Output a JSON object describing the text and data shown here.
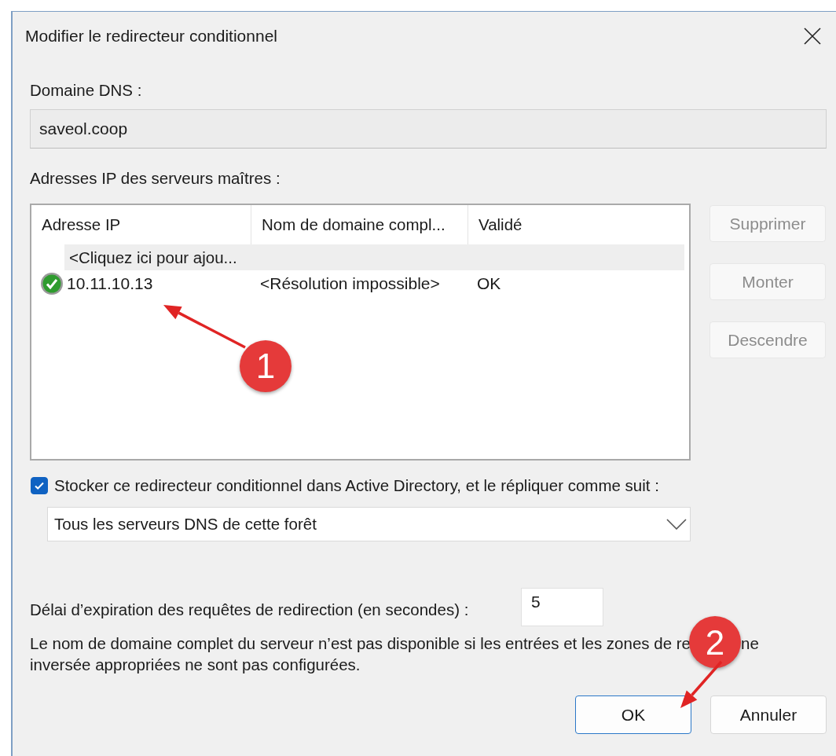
{
  "window": {
    "title": "Modifier le redirecteur conditionnel"
  },
  "dns_domain": {
    "label": "Domaine DNS :",
    "value": "saveol.coop"
  },
  "masters": {
    "label": "Adresses IP des serveurs maîtres :",
    "columns": [
      "Adresse IP",
      "Nom de domaine compl...",
      "Validé"
    ],
    "rows": [
      {
        "kind": "add",
        "selected": true,
        "cells": [
          "<Cliquez ici pour ajou..."
        ]
      },
      {
        "kind": "server",
        "validated": true,
        "selected": false,
        "cells": [
          "10.11.10.13",
          "<Résolution impossible>",
          "OK"
        ]
      }
    ]
  },
  "side_buttons": [
    {
      "label": "Supprimer",
      "disabled": true
    },
    {
      "label": "Monter",
      "disabled": true
    },
    {
      "label": "Descendre",
      "disabled": true
    }
  ],
  "store": {
    "label": "Stocker ce redirecteur conditionnel dans Active Directory, et le répliquer comme suit :",
    "checked": true
  },
  "replication": {
    "value": "Tous les serveurs DNS de cette forêt"
  },
  "timeout": {
    "label": "Délai d’expiration des requêtes de redirection (en secondes) :",
    "value": "5"
  },
  "note": {
    "line_start": "Le nom de domaine complet du serveur n’est pas disponible si les entrées et les zones de re",
    "line_end": "ne",
    "next_line": "inversée appropriées ne sont pas configurées."
  },
  "buttons": [
    {
      "label": "OK",
      "default": true
    },
    {
      "label": "Annuler",
      "default": false
    }
  ],
  "annotations": [
    {
      "label": "1"
    },
    {
      "label": "2"
    }
  ]
}
